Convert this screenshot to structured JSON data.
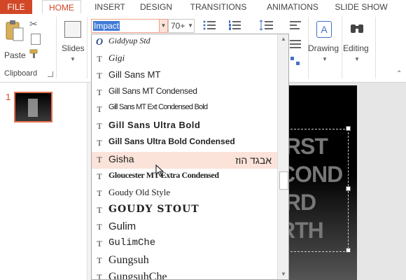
{
  "tabs": [
    "FILE",
    "HOME",
    "INSERT",
    "DESIGN",
    "TRANSITIONS",
    "ANIMATIONS",
    "SLIDE SHOW"
  ],
  "ribbon": {
    "paste_label": "Paste",
    "slides_label": "Slides",
    "clipboard_label": "Clipboard",
    "drawing_label": "Drawing",
    "editing_label": "Editing",
    "font_name_value": "Impact",
    "font_size_value": "70+"
  },
  "thumbnails": {
    "slide_number": "1"
  },
  "font_list": [
    {
      "name": "Giddyup Std",
      "icon": "O",
      "preview": ""
    },
    {
      "name": "Gigi",
      "icon": "T",
      "preview": ""
    },
    {
      "name": "Gill Sans MT",
      "icon": "T",
      "preview": ""
    },
    {
      "name": "Gill Sans MT Condensed",
      "icon": "T",
      "preview": ""
    },
    {
      "name": "Gill Sans MT Ext Condensed Bold",
      "icon": "T",
      "preview": ""
    },
    {
      "name": "Gill Sans Ultra Bold",
      "icon": "T",
      "preview": ""
    },
    {
      "name": "Gill Sans Ultra Bold Condensed",
      "icon": "T",
      "preview": ""
    },
    {
      "name": "Gisha",
      "icon": "T",
      "preview": "אבגד הוז"
    },
    {
      "name": "Gloucester MT Extra Condensed",
      "icon": "T",
      "preview": ""
    },
    {
      "name": "Goudy Old Style",
      "icon": "T",
      "preview": ""
    },
    {
      "name": "GOUDY STOUT",
      "icon": "T",
      "preview": ""
    },
    {
      "name": "Gulim",
      "icon": "T",
      "preview": ""
    },
    {
      "name": "GulimChe",
      "icon": "T",
      "preview": ""
    },
    {
      "name": "Gungsuh",
      "icon": "T",
      "preview": ""
    },
    {
      "name": "GungsuhChe",
      "icon": "T",
      "preview": ""
    }
  ],
  "highlighted_font": "Gisha",
  "slide_text": [
    "IRST",
    "COND",
    "IRD",
    "RTH"
  ],
  "colors": {
    "accent": "#d24726",
    "highlight": "#fbe3da",
    "selection": "#3f7bd7"
  }
}
